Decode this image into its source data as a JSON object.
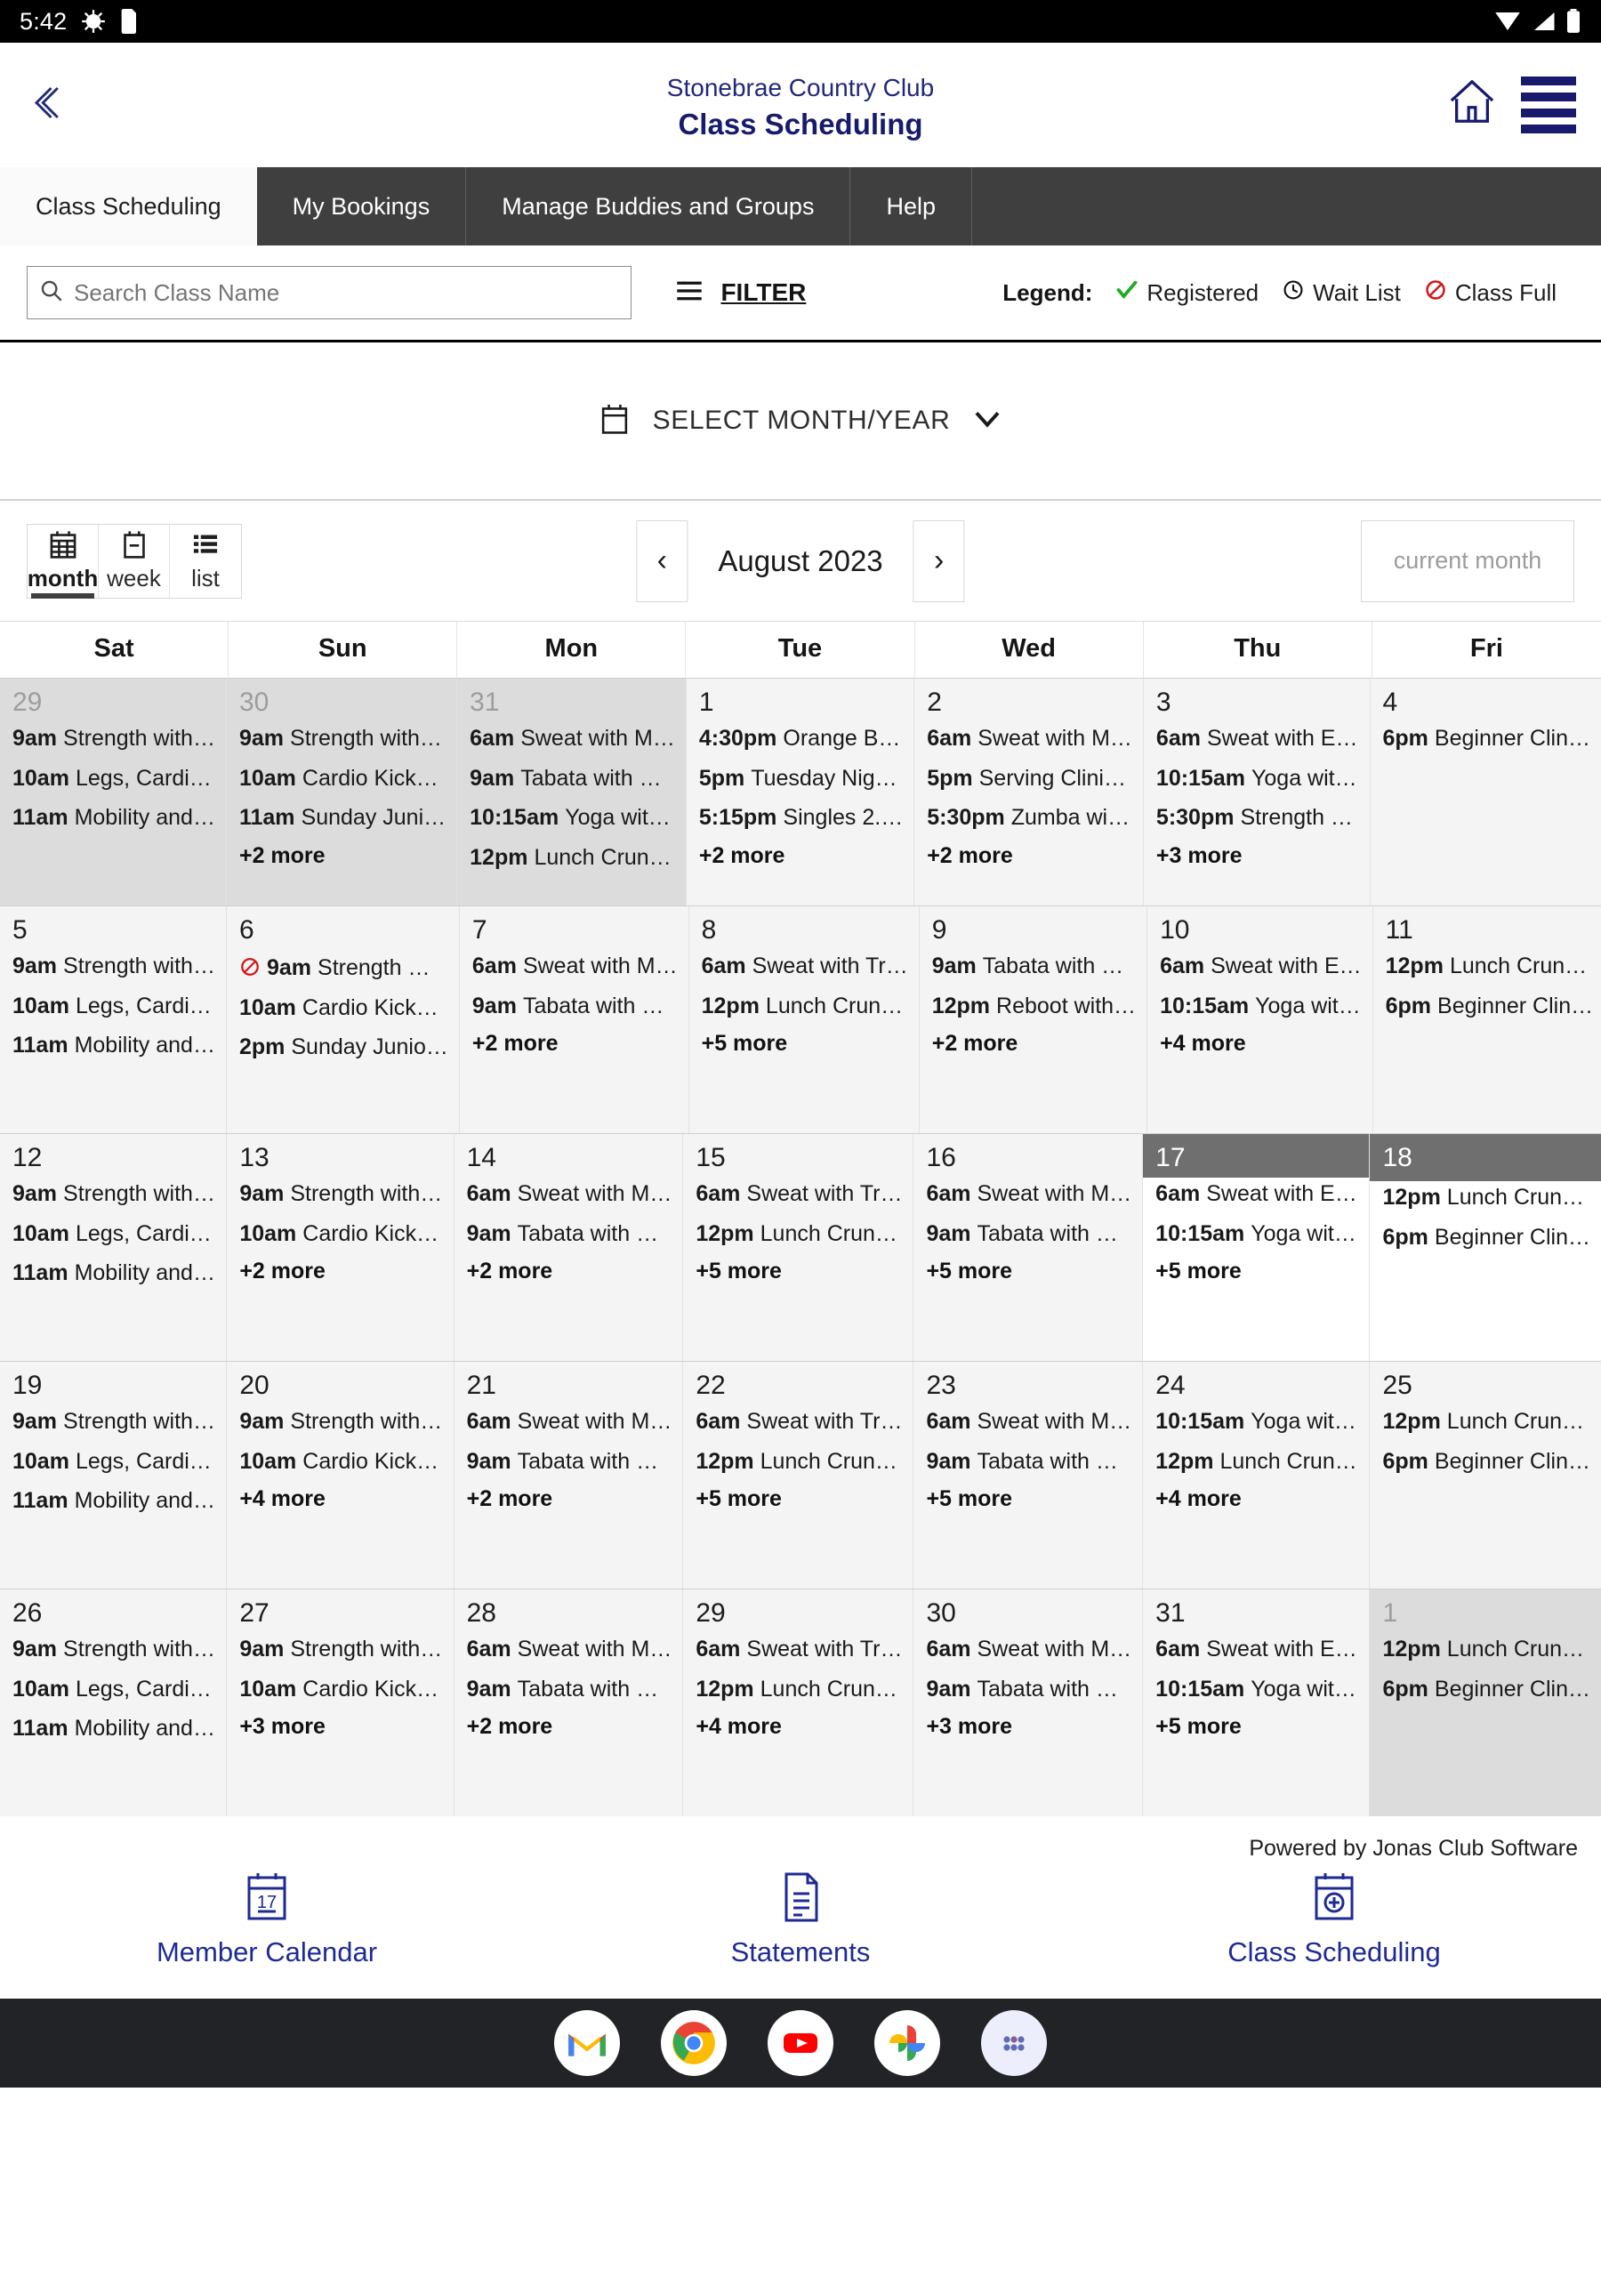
{
  "statusbar": {
    "time": "5:42",
    "icons": [
      "android-debug-icon",
      "sim-card-icon",
      "wifi-icon",
      "signal-icon",
      "battery-icon"
    ]
  },
  "header": {
    "club_name": "Stonebrae Country Club",
    "page_title": "Class Scheduling",
    "back_icon": "back-chevron-icon",
    "home_icon": "home-icon",
    "menu_icon": "hamburger-menu-icon",
    "brand_color": "#181a6e"
  },
  "tabs": [
    {
      "label": "Class Scheduling",
      "active": true
    },
    {
      "label": "My Bookings",
      "active": false
    },
    {
      "label": "Manage Buddies and Groups",
      "active": false
    },
    {
      "label": "Help",
      "active": false
    }
  ],
  "search": {
    "placeholder": "Search Class Name",
    "value": "",
    "icon": "search-icon"
  },
  "filter": {
    "label": "FILTER",
    "icon": "filter-icon"
  },
  "legend": {
    "title": "Legend:",
    "items": [
      {
        "label": "Registered",
        "icon": "check-icon",
        "color": "#22aa22"
      },
      {
        "label": "Wait List",
        "icon": "clock-icon",
        "color": "#111111"
      },
      {
        "label": "Class Full",
        "icon": "no-entry-icon",
        "color": "#d01818"
      }
    ]
  },
  "month_selector": {
    "label": "SELECT MONTH/YEAR",
    "calendar_icon": "calendar-icon",
    "chevron": "chevron-down-icon"
  },
  "calendar_toolbar": {
    "views": [
      {
        "label": "month",
        "icon": "calendar-month-icon",
        "active": true
      },
      {
        "label": "week",
        "icon": "calendar-week-icon",
        "active": false
      },
      {
        "label": "list",
        "icon": "list-icon",
        "active": false
      }
    ],
    "prev": "‹",
    "next": "›",
    "title": "August 2023",
    "current_month_label": "current month"
  },
  "calendar": {
    "day_headers": [
      "Sat",
      "Sun",
      "Mon",
      "Tue",
      "Wed",
      "Thu",
      "Fri"
    ],
    "weeks": [
      [
        {
          "num": "29",
          "other": true,
          "events": [
            {
              "time": "9am",
              "name": "Strength with…"
            },
            {
              "time": "10am",
              "name": "Legs, Cardi…"
            },
            {
              "time": "11am",
              "name": "Mobility and…"
            }
          ],
          "more": ""
        },
        {
          "num": "30",
          "other": true,
          "events": [
            {
              "time": "9am",
              "name": "Strength with…"
            },
            {
              "time": "10am",
              "name": "Cardio Kick…"
            },
            {
              "time": "11am",
              "name": "Sunday Juni…"
            }
          ],
          "more": "+2 more"
        },
        {
          "num": "31",
          "other": true,
          "events": [
            {
              "time": "6am",
              "name": "Sweat with M…"
            },
            {
              "time": "9am",
              "name": "Tabata with …"
            },
            {
              "time": "10:15am",
              "name": "Yoga wit…"
            },
            {
              "time": "12pm",
              "name": "Lunch Crun…"
            }
          ],
          "more": ""
        },
        {
          "num": "1",
          "other": false,
          "events": [
            {
              "time": "4:30pm",
              "name": "Orange B…"
            },
            {
              "time": "5pm",
              "name": "Tuesday Nig…"
            },
            {
              "time": "5:15pm",
              "name": "Singles 2.…"
            }
          ],
          "more": "+2 more"
        },
        {
          "num": "2",
          "other": false,
          "events": [
            {
              "time": "6am",
              "name": "Sweat with M…"
            },
            {
              "time": "5pm",
              "name": "Serving Clini…"
            },
            {
              "time": "5:30pm",
              "name": "Zumba wi…"
            }
          ],
          "more": "+2 more"
        },
        {
          "num": "3",
          "other": false,
          "events": [
            {
              "time": "6am",
              "name": "Sweat with E…"
            },
            {
              "time": "10:15am",
              "name": "Yoga wit…"
            },
            {
              "time": "5:30pm",
              "name": "Strength …"
            }
          ],
          "more": "+3 more"
        },
        {
          "num": "4",
          "other": false,
          "events": [
            {
              "time": "6pm",
              "name": "Beginner Clin…"
            }
          ],
          "more": ""
        }
      ],
      [
        {
          "num": "5",
          "other": false,
          "events": [
            {
              "time": "9am",
              "name": "Strength with…"
            },
            {
              "time": "10am",
              "name": "Legs, Cardi…"
            },
            {
              "time": "11am",
              "name": "Mobility and…"
            }
          ],
          "more": ""
        },
        {
          "num": "6",
          "other": false,
          "events": [
            {
              "time": "9am",
              "name": "Strength …",
              "status": "full"
            },
            {
              "time": "10am",
              "name": "Cardio Kick…"
            },
            {
              "time": "2pm",
              "name": "Sunday Junio…"
            }
          ],
          "more": ""
        },
        {
          "num": "7",
          "other": false,
          "events": [
            {
              "time": "6am",
              "name": "Sweat with M…"
            },
            {
              "time": "9am",
              "name": "Tabata with …"
            }
          ],
          "more": "+2 more"
        },
        {
          "num": "8",
          "other": false,
          "events": [
            {
              "time": "6am",
              "name": "Sweat with Tr…"
            },
            {
              "time": "12pm",
              "name": "Lunch Crun…"
            }
          ],
          "more": "+5 more"
        },
        {
          "num": "9",
          "other": false,
          "events": [
            {
              "time": "9am",
              "name": "Tabata with …"
            },
            {
              "time": "12pm",
              "name": "Reboot with…"
            }
          ],
          "more": "+2 more"
        },
        {
          "num": "10",
          "other": false,
          "events": [
            {
              "time": "6am",
              "name": "Sweat with E…"
            },
            {
              "time": "10:15am",
              "name": "Yoga wit…"
            }
          ],
          "more": "+4 more"
        },
        {
          "num": "11",
          "other": false,
          "events": [
            {
              "time": "12pm",
              "name": "Lunch Crun…"
            },
            {
              "time": "6pm",
              "name": "Beginner Clin…"
            }
          ],
          "more": ""
        }
      ],
      [
        {
          "num": "12",
          "other": false,
          "events": [
            {
              "time": "9am",
              "name": "Strength with…"
            },
            {
              "time": "10am",
              "name": "Legs, Cardi…"
            },
            {
              "time": "11am",
              "name": "Mobility and…"
            }
          ],
          "more": ""
        },
        {
          "num": "13",
          "other": false,
          "events": [
            {
              "time": "9am",
              "name": "Strength with…"
            },
            {
              "time": "10am",
              "name": "Cardio Kick…"
            }
          ],
          "more": "+2 more"
        },
        {
          "num": "14",
          "other": false,
          "events": [
            {
              "time": "6am",
              "name": "Sweat with M…"
            },
            {
              "time": "9am",
              "name": "Tabata with …"
            }
          ],
          "more": "+2 more"
        },
        {
          "num": "15",
          "other": false,
          "events": [
            {
              "time": "6am",
              "name": "Sweat with Tr…"
            },
            {
              "time": "12pm",
              "name": "Lunch Crun…"
            }
          ],
          "more": "+5 more"
        },
        {
          "num": "16",
          "other": false,
          "events": [
            {
              "time": "6am",
              "name": "Sweat with M…"
            },
            {
              "time": "9am",
              "name": "Tabata with …"
            }
          ],
          "more": "+5 more"
        },
        {
          "num": "17",
          "other": false,
          "today": true,
          "events": [
            {
              "time": "6am",
              "name": "Sweat with E…"
            },
            {
              "time": "10:15am",
              "name": "Yoga wit…"
            }
          ],
          "more": "+5 more"
        },
        {
          "num": "18",
          "other": false,
          "today_white": true,
          "events": [
            {
              "time": "12pm",
              "name": "Lunch Crun…"
            },
            {
              "time": "6pm",
              "name": "Beginner Clin…"
            }
          ],
          "more": ""
        }
      ],
      [
        {
          "num": "19",
          "other": false,
          "events": [
            {
              "time": "9am",
              "name": "Strength with…"
            },
            {
              "time": "10am",
              "name": "Legs, Cardi…"
            },
            {
              "time": "11am",
              "name": "Mobility and…"
            }
          ],
          "more": ""
        },
        {
          "num": "20",
          "other": false,
          "events": [
            {
              "time": "9am",
              "name": "Strength with…"
            },
            {
              "time": "10am",
              "name": "Cardio Kick…"
            }
          ],
          "more": "+4 more"
        },
        {
          "num": "21",
          "other": false,
          "events": [
            {
              "time": "6am",
              "name": "Sweat with M…"
            },
            {
              "time": "9am",
              "name": "Tabata with …"
            }
          ],
          "more": "+2 more"
        },
        {
          "num": "22",
          "other": false,
          "events": [
            {
              "time": "6am",
              "name": "Sweat with Tr…"
            },
            {
              "time": "12pm",
              "name": "Lunch Crun…"
            }
          ],
          "more": "+5 more"
        },
        {
          "num": "23",
          "other": false,
          "events": [
            {
              "time": "6am",
              "name": "Sweat with M…"
            },
            {
              "time": "9am",
              "name": "Tabata with …"
            }
          ],
          "more": "+5 more"
        },
        {
          "num": "24",
          "other": false,
          "events": [
            {
              "time": "10:15am",
              "name": "Yoga wit…"
            },
            {
              "time": "12pm",
              "name": "Lunch Crun…"
            }
          ],
          "more": "+4 more"
        },
        {
          "num": "25",
          "other": false,
          "events": [
            {
              "time": "12pm",
              "name": "Lunch Crun…"
            },
            {
              "time": "6pm",
              "name": "Beginner Clin…"
            }
          ],
          "more": ""
        }
      ],
      [
        {
          "num": "26",
          "other": false,
          "events": [
            {
              "time": "9am",
              "name": "Strength with…"
            },
            {
              "time": "10am",
              "name": "Legs, Cardi…"
            },
            {
              "time": "11am",
              "name": "Mobility and…"
            }
          ],
          "more": ""
        },
        {
          "num": "27",
          "other": false,
          "events": [
            {
              "time": "9am",
              "name": "Strength with…"
            },
            {
              "time": "10am",
              "name": "Cardio Kick…"
            }
          ],
          "more": "+3 more"
        },
        {
          "num": "28",
          "other": false,
          "events": [
            {
              "time": "6am",
              "name": "Sweat with M…"
            },
            {
              "time": "9am",
              "name": "Tabata with …"
            }
          ],
          "more": "+2 more"
        },
        {
          "num": "29",
          "other": false,
          "events": [
            {
              "time": "6am",
              "name": "Sweat with Tr…"
            },
            {
              "time": "12pm",
              "name": "Lunch Crun…"
            }
          ],
          "more": "+4 more"
        },
        {
          "num": "30",
          "other": false,
          "events": [
            {
              "time": "6am",
              "name": "Sweat with M…"
            },
            {
              "time": "9am",
              "name": "Tabata with …"
            }
          ],
          "more": "+3 more"
        },
        {
          "num": "31",
          "other": false,
          "events": [
            {
              "time": "6am",
              "name": "Sweat with E…"
            },
            {
              "time": "10:15am",
              "name": "Yoga wit…"
            }
          ],
          "more": "+5 more"
        },
        {
          "num": "1",
          "other": true,
          "events": [
            {
              "time": "12pm",
              "name": "Lunch Crun…"
            },
            {
              "time": "6pm",
              "name": "Beginner Clin…"
            }
          ],
          "more": ""
        }
      ]
    ]
  },
  "footer": {
    "powered_by": "Powered by Jonas Club Software",
    "items": [
      {
        "label": "Member Calendar",
        "icon": "calendar-17-icon",
        "badge": "17"
      },
      {
        "label": "Statements",
        "icon": "document-icon"
      },
      {
        "label": "Class Scheduling",
        "icon": "calendar-plus-icon"
      }
    ],
    "link_color": "#1e2a94"
  },
  "dock": {
    "apps": [
      "gmail-icon",
      "chrome-icon",
      "youtube-icon",
      "google-photos-icon",
      "app-drawer-icon"
    ]
  }
}
